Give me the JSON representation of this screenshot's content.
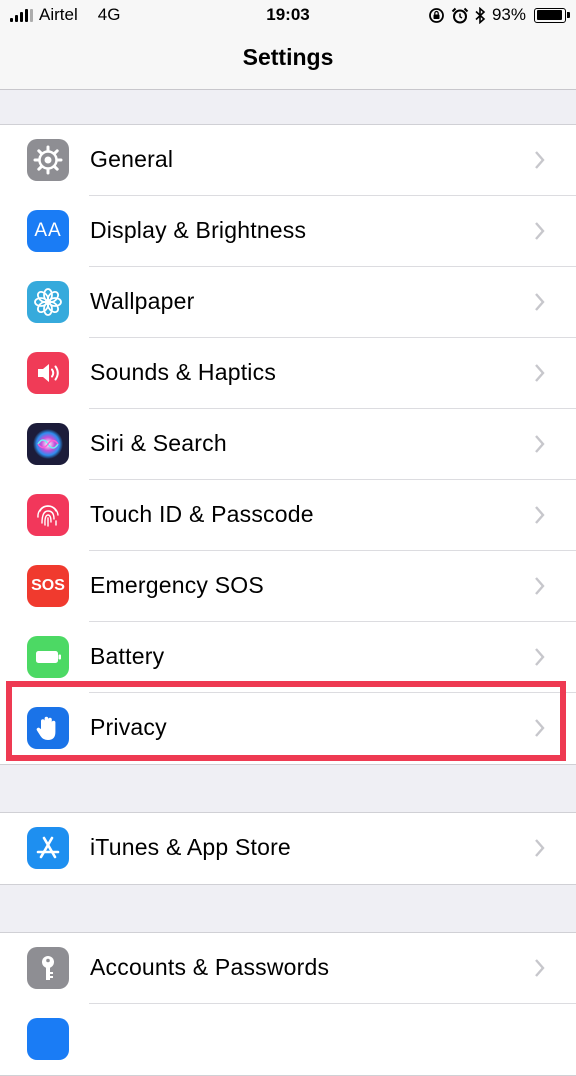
{
  "status_bar": {
    "carrier": "Airtel",
    "network": "4G",
    "time": "19:03",
    "battery_text": "93%",
    "battery_level": 0.93
  },
  "nav": {
    "title": "Settings"
  },
  "colors": {
    "general": "#8e8e93",
    "display": "#1a7cf5",
    "wallpaper": "#36aadc",
    "sounds": "#f03b57",
    "siri": "#1c1c3a",
    "touch_id": "#f2375b",
    "sos": "#f03a2e",
    "battery": "#4cd964",
    "privacy": "#1a73e8",
    "itunes": "#1e8ff0",
    "accounts": "#8e8e93",
    "highlight": "#ee3a52"
  },
  "group1": [
    {
      "label": "General",
      "icon": "gear-icon"
    },
    {
      "label": "Display & Brightness",
      "icon": "text-size-icon",
      "icon_text": "AA"
    },
    {
      "label": "Wallpaper",
      "icon": "flower-icon"
    },
    {
      "label": "Sounds & Haptics",
      "icon": "speaker-icon"
    },
    {
      "label": "Siri & Search",
      "icon": "siri-icon"
    },
    {
      "label": "Touch ID & Passcode",
      "icon": "fingerprint-icon"
    },
    {
      "label": "Emergency SOS",
      "icon": "sos-icon",
      "icon_text": "SOS"
    },
    {
      "label": "Battery",
      "icon": "battery-icon"
    },
    {
      "label": "Privacy",
      "icon": "hand-icon"
    }
  ],
  "group2": [
    {
      "label": "iTunes & App Store",
      "icon": "app-store-icon"
    }
  ],
  "group3": [
    {
      "label": "Accounts & Passwords",
      "icon": "key-icon"
    }
  ]
}
